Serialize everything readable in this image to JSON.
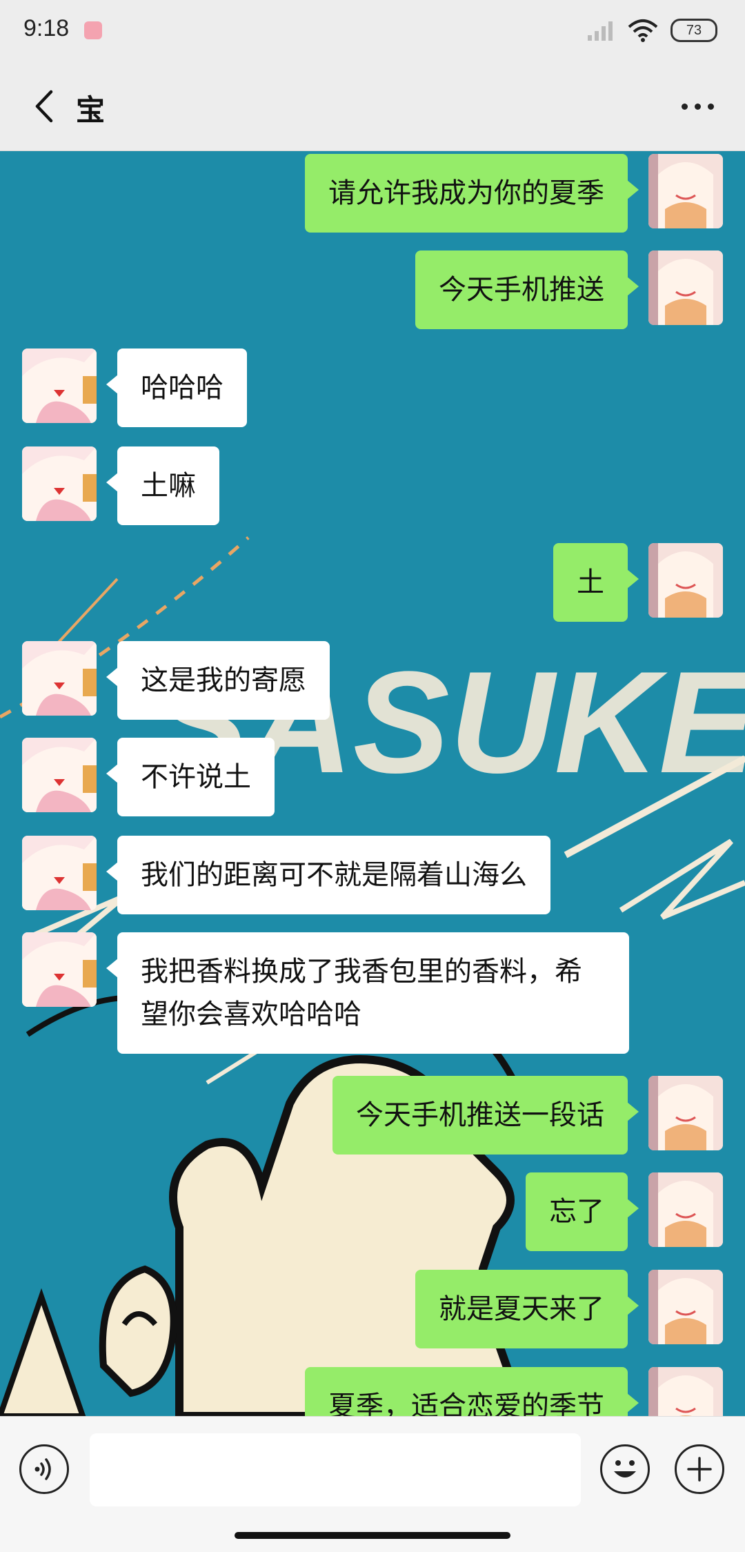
{
  "status_bar": {
    "time": "9:18",
    "battery": "73"
  },
  "header": {
    "title": "宝"
  },
  "messages": [
    {
      "from": "me",
      "text": "请允许我成为你的夏季"
    },
    {
      "from": "me",
      "text": "今天手机推送"
    },
    {
      "from": "them",
      "text": "哈哈哈"
    },
    {
      "from": "them",
      "text": "土嘛"
    },
    {
      "from": "me",
      "text": "土"
    },
    {
      "from": "them",
      "text": "这是我的寄愿"
    },
    {
      "from": "them",
      "text": "不许说土"
    },
    {
      "from": "them",
      "text": "我们的距离可不就是隔着山海么"
    },
    {
      "from": "them",
      "text": "我把香料换成了我香包里的香料，希望你会喜欢哈哈哈"
    },
    {
      "from": "me",
      "text": "今天手机推送一段话"
    },
    {
      "from": "me",
      "text": "忘了"
    },
    {
      "from": "me",
      "text": "就是夏天来了"
    },
    {
      "from": "me",
      "text": "夏季，适合恋爱的季节"
    }
  ],
  "background_art_text": "SASUKE",
  "colors": {
    "my_bubble": "#95ec69",
    "their_bubble": "#ffffff",
    "chat_bg": "#1d8ca8"
  }
}
